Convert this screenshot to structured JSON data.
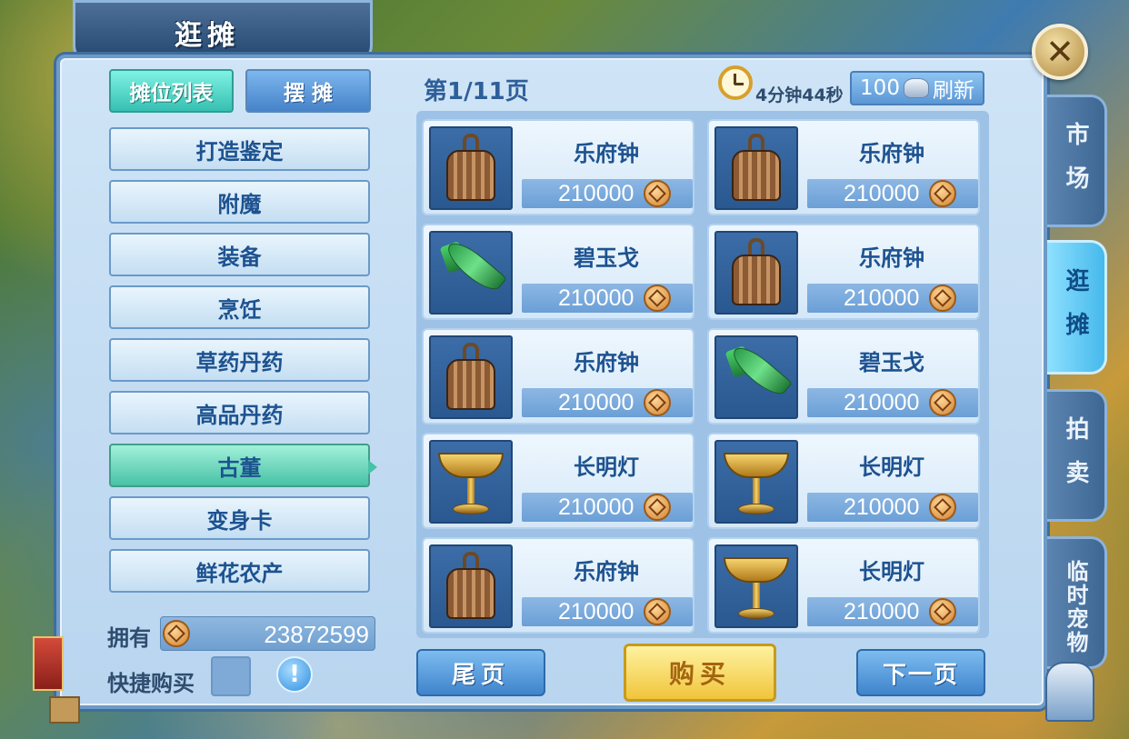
{
  "window": {
    "title": "逛摊"
  },
  "top_tabs": {
    "list": "摊位列表",
    "stall": "摆 摊"
  },
  "categories": [
    {
      "label": "打造鉴定",
      "active": false
    },
    {
      "label": "附魔",
      "active": false
    },
    {
      "label": "装备",
      "active": false
    },
    {
      "label": "烹饪",
      "active": false
    },
    {
      "label": "草药丹药",
      "active": false
    },
    {
      "label": "高品丹药",
      "active": false
    },
    {
      "label": "古董",
      "active": true
    },
    {
      "label": "变身卡",
      "active": false
    },
    {
      "label": "鲜花农产",
      "active": false
    }
  ],
  "owned": {
    "label": "拥有",
    "value": "23872599",
    "icon": "copper-coin-icon"
  },
  "quick_buy": {
    "label": "快捷购买",
    "checked": false,
    "info_icon": "!"
  },
  "pagination": {
    "page_label": "第1/11页"
  },
  "timer": {
    "text": "4分钟44秒",
    "icon": "clock-icon"
  },
  "refresh": {
    "cost": "100",
    "label": "刷新",
    "icon": "silver-ingot-icon"
  },
  "items": [
    {
      "name": "乐府钟",
      "price": "210000",
      "icon": "bell-icon"
    },
    {
      "name": "乐府钟",
      "price": "210000",
      "icon": "bell-icon"
    },
    {
      "name": "碧玉戈",
      "price": "210000",
      "icon": "jade-dagger-icon"
    },
    {
      "name": "乐府钟",
      "price": "210000",
      "icon": "bell-icon"
    },
    {
      "name": "乐府钟",
      "price": "210000",
      "icon": "bell-icon"
    },
    {
      "name": "碧玉戈",
      "price": "210000",
      "icon": "jade-dagger-icon"
    },
    {
      "name": "长明灯",
      "price": "210000",
      "icon": "lamp-icon"
    },
    {
      "name": "长明灯",
      "price": "210000",
      "icon": "lamp-icon"
    },
    {
      "name": "乐府钟",
      "price": "210000",
      "icon": "bell-icon"
    },
    {
      "name": "长明灯",
      "price": "210000",
      "icon": "lamp-icon"
    }
  ],
  "bottom_buttons": {
    "last_page": "尾页",
    "buy": "购买",
    "next_page": "下一页"
  },
  "side_tabs": [
    {
      "label": "市场",
      "active": false
    },
    {
      "label": "逛摊",
      "active": true
    },
    {
      "label": "拍卖",
      "active": false
    },
    {
      "label": "临时宠物",
      "active": false
    }
  ],
  "colors": {
    "accent_teal": "#36c0b2",
    "panel_blue": "#b9d5ef",
    "buy_yellow": "#f0c53a",
    "text_blue": "#1d5290"
  }
}
